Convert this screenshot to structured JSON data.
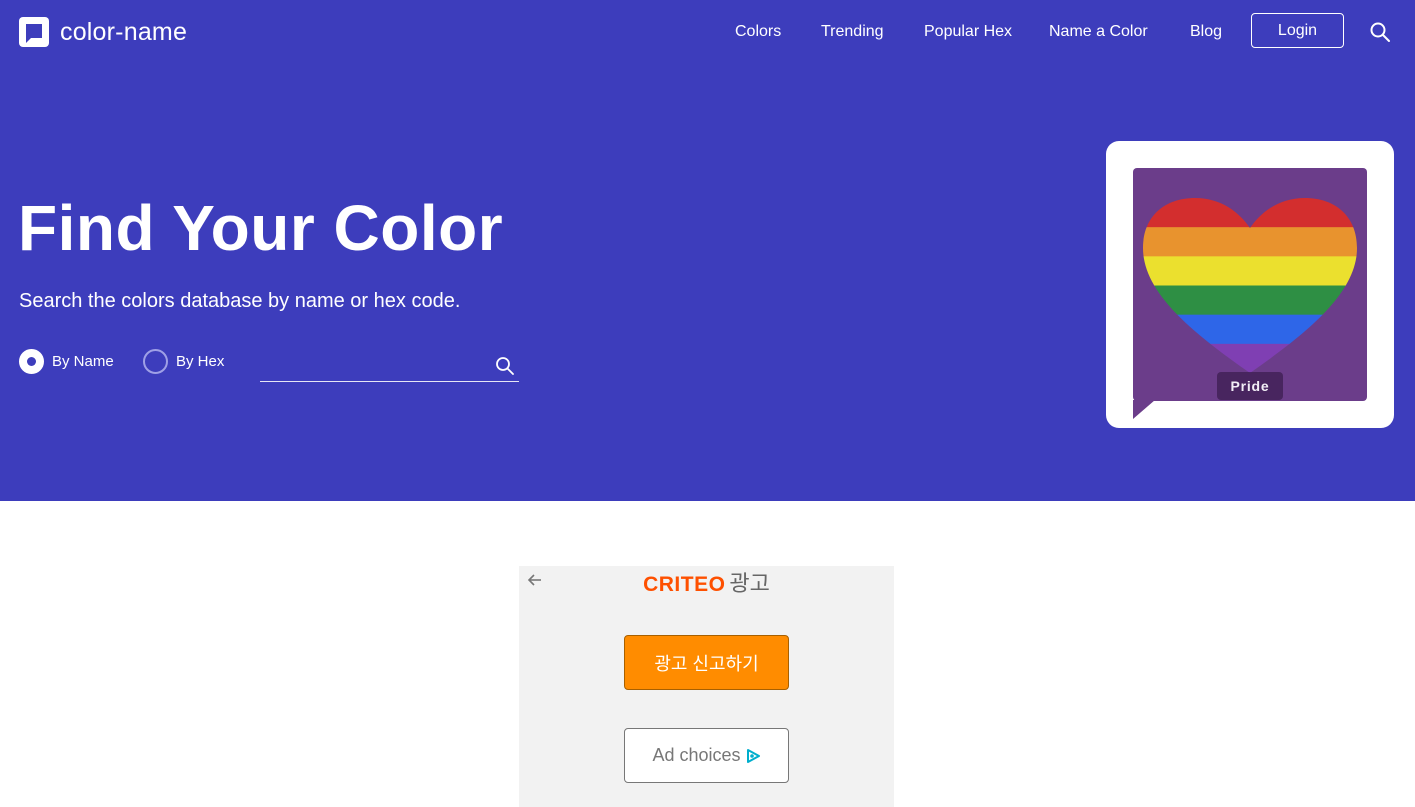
{
  "brand": {
    "name": "color-name",
    "icon": "logo-chat-square-icon"
  },
  "nav": {
    "links": [
      "Colors",
      "Trending",
      "Popular Hex",
      "Name a Color",
      "Blog"
    ],
    "login": "Login",
    "search_icon": "search-icon"
  },
  "hero": {
    "title": "Find Your Color",
    "subtitle": "Search the colors database by name or hex code.",
    "options": [
      {
        "label": "By Name",
        "checked": true
      },
      {
        "label": "By Hex",
        "checked": false
      }
    ],
    "search_placeholder": ""
  },
  "featured": {
    "label": "Pride",
    "image": "rainbow-heart-icon"
  },
  "ad": {
    "brand": "CRITEO",
    "word": "광고",
    "report_button": "광고 신고하기",
    "choices_button": "Ad choices"
  },
  "colors": {
    "hero_bg": "#3d3dbc",
    "criteo_orange": "#fe5000",
    "report_orange": "#ff8c00",
    "rainbow": [
      "#d32e2e",
      "#e8932e",
      "#ebe02e",
      "#2e8f44",
      "#2e66e8",
      "#7f3fb3"
    ]
  }
}
